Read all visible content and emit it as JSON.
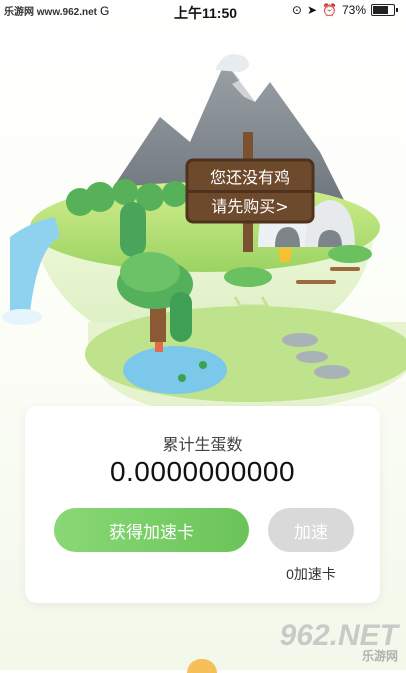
{
  "status_bar": {
    "watermark": "乐游网 www.962.net",
    "carrier": "G",
    "time": "上午11:50",
    "battery": "73%"
  },
  "scene": {
    "sign_line1": "您还没有鸡",
    "sign_line2": "请先购买>"
  },
  "card": {
    "title": "累计生蛋数",
    "value": "0.0000000000",
    "get_card_button": "获得加速卡",
    "speed_button": "加速",
    "card_count": "0加速卡"
  },
  "watermark": {
    "brand": "962.NET",
    "sub": "乐游网"
  },
  "colors": {
    "accent_green": "#6ac458",
    "disabled_gray": "#d9d9d9"
  }
}
